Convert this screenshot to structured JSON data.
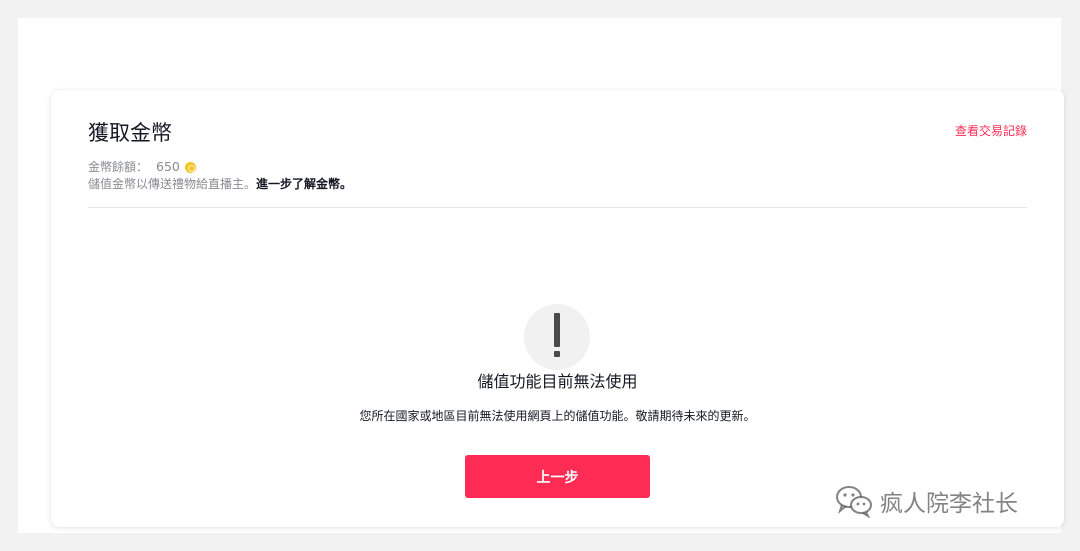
{
  "header": {
    "title": "獲取金幣",
    "history_link": "查看交易記錄"
  },
  "balance": {
    "label": "金幣餘額：",
    "amount": "650",
    "coin_icon": "coin-icon"
  },
  "description": {
    "text": "儲值金幣以傳送禮物給直播主。",
    "learn_more": "進一步了解金幣。"
  },
  "notice": {
    "icon": "exclamation-icon",
    "title": "儲值功能目前無法使用",
    "message": "您所在國家或地區目前無法使用網頁上的儲值功能。敬請期待未來的更新。"
  },
  "actions": {
    "back_label": "上一步"
  },
  "watermark": {
    "icon": "wechat-icon",
    "text": "疯人院李社长"
  },
  "colors": {
    "accent": "#fe2c55",
    "coin": "#f7c325",
    "text_primary": "#161823",
    "text_secondary": "#8a8b91"
  }
}
